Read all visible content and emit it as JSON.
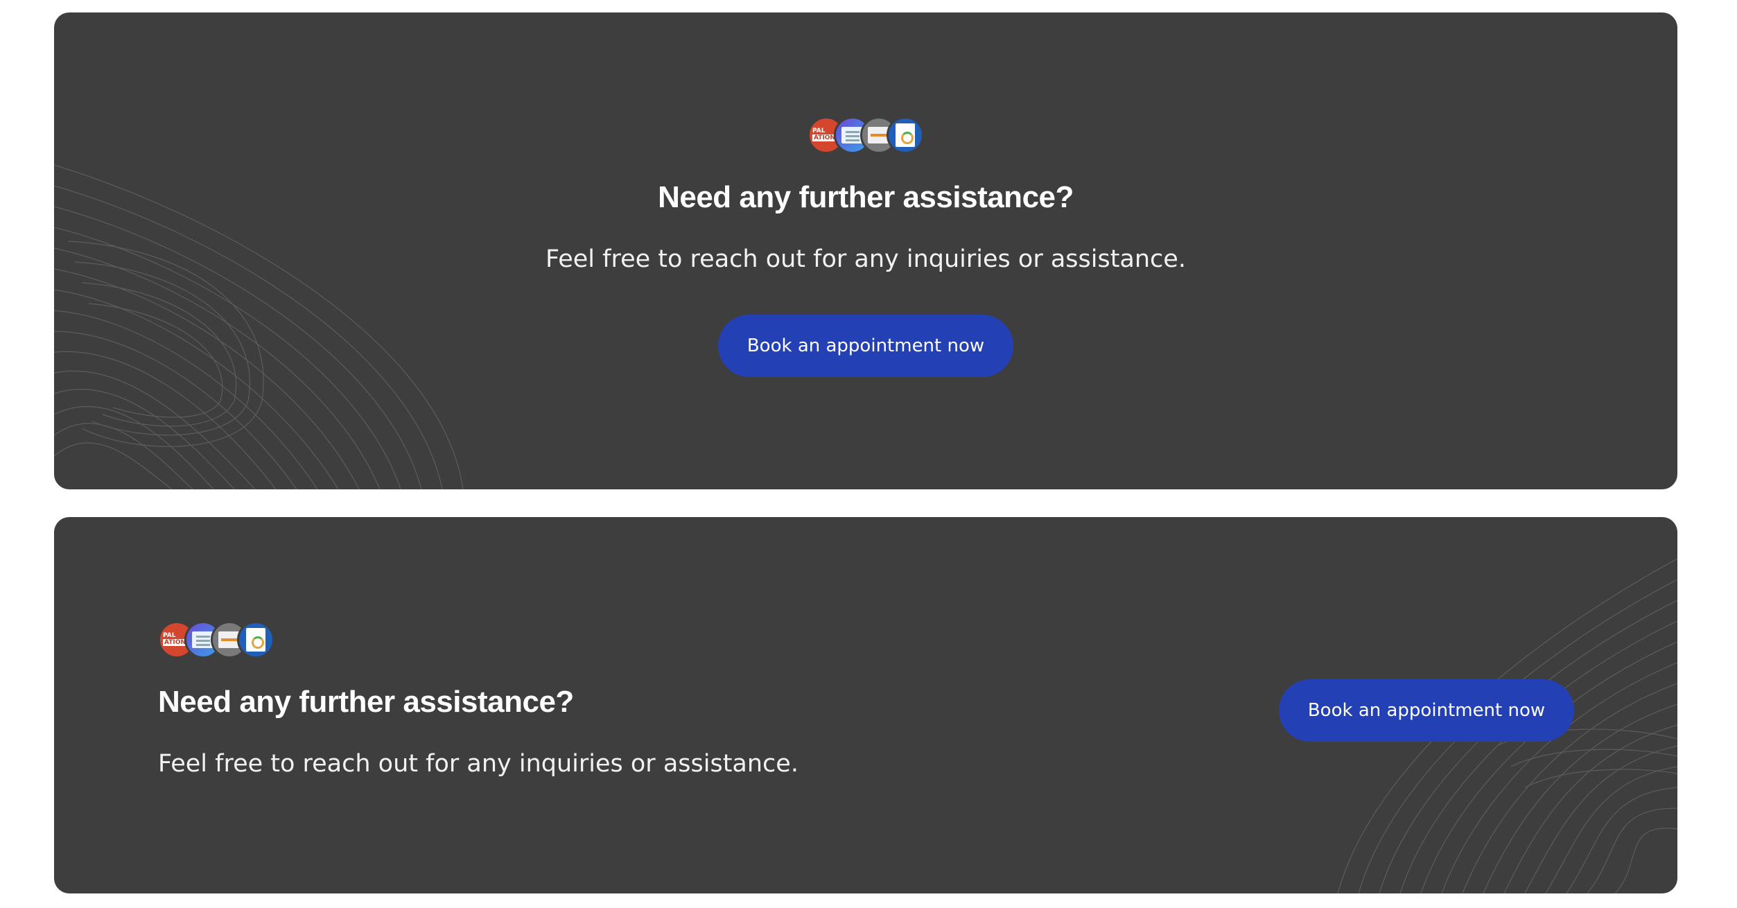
{
  "banners": [
    {
      "layout": "centered",
      "title": "Need any further assistance?",
      "subtitle": "Feel free to reach out for any inquiries or assistance.",
      "button_label": "Book an appointment now",
      "avatar_thumbnails": [
        "thumb-red-badge",
        "thumb-purple-doc",
        "thumb-grey-doc",
        "thumb-blue-doc"
      ],
      "avatar_text": [
        "PAL",
        "ATION"
      ]
    },
    {
      "layout": "split",
      "title": "Need any further assistance?",
      "subtitle": "Feel free to reach out for any inquiries or assistance.",
      "button_label": "Book an appointment now",
      "avatar_thumbnails": [
        "thumb-red-badge",
        "thumb-purple-doc",
        "thumb-grey-doc",
        "thumb-blue-doc"
      ],
      "avatar_text": [
        "PAL",
        "ATION"
      ]
    }
  ],
  "colors": {
    "card_background": "#3e3e3e",
    "button_background": "#2341b5",
    "text": "#ffffff",
    "page_background": "#ffffff"
  }
}
